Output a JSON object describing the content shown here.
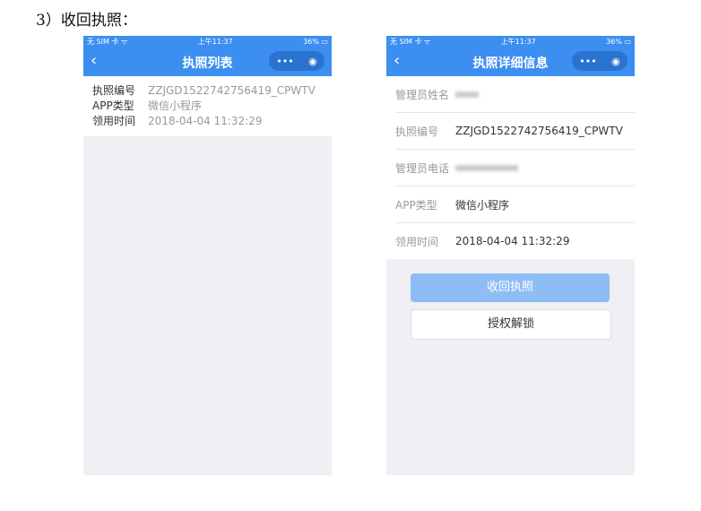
{
  "heading": "3）收回执照：",
  "status": {
    "carrier": "无 SIM 卡 ᯤ",
    "time": "上午11:37",
    "battery": "36% ▭"
  },
  "nav": {
    "back": "‹",
    "menu": "•••",
    "close": "◉"
  },
  "left": {
    "title": "执照列表",
    "items": [
      {
        "k": "执照编号",
        "v": "ZZJGD1522742756419_CPWTV"
      },
      {
        "k": "APP类型",
        "v": "微信小程序"
      },
      {
        "k": "领用时间",
        "v": "2018-04-04 11:32:29"
      }
    ]
  },
  "right": {
    "title": "执照详细信息",
    "rows": [
      {
        "k": "管理员姓名",
        "v": ""
      },
      {
        "k": "执照编号",
        "v": "ZZJGD1522742756419_CPWTV"
      },
      {
        "k": "管理员电话",
        "v": ""
      },
      {
        "k": "APP类型",
        "v": "微信小程序"
      },
      {
        "k": "领用时间",
        "v": "2018-04-04 11:32:29"
      }
    ],
    "revoke": "收回执照",
    "unlock": "授权解锁"
  }
}
